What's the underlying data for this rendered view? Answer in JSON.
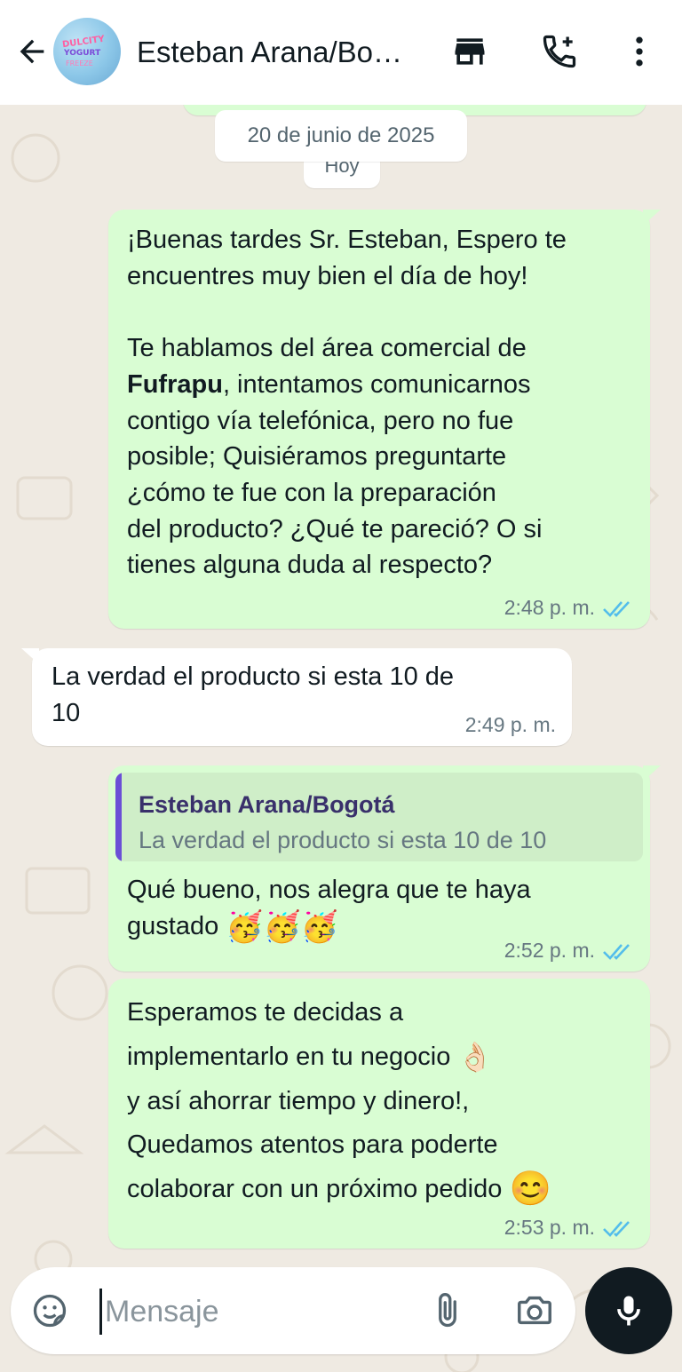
{
  "header": {
    "contact_name": "Esteban Arana/Bo…",
    "icons": {
      "back": "arrow-left-icon",
      "store": "storefront-icon",
      "call": "phone-add-icon",
      "menu": "more-vertical-icon"
    },
    "avatar_text": [
      "DULCITY",
      "YOGURT",
      "FREEZE"
    ]
  },
  "chat": {
    "date_chip": "20 de junio de 2025",
    "today_chip": "Hoy",
    "messages": [
      {
        "direction": "out",
        "line1": "¡Buenas tardes Sr. Esteban, Espero te",
        "line2": "encuentres muy bien el día de hoy!",
        "line3": "Te hablamos del área comercial de",
        "bold_word": "Fufrapu",
        "line4_rest": ", intentamos comunicarnos",
        "line5": "contigo vía telefónica, pero no fue",
        "line6": "posible; Quisiéramos preguntarte",
        "line7": "¿cómo te fue con la preparación",
        "line8": "del producto? ¿Qué te pareció? O si",
        "line9": "tienes alguna duda al respecto?",
        "time": "2:48 p. m.",
        "status": "read"
      },
      {
        "direction": "in",
        "line1": "La verdad el producto si esta 10 de",
        "line2": "10",
        "time": "2:49 p. m."
      },
      {
        "direction": "out",
        "quote_author": "Esteban Arana/Bogotá",
        "quote_text": "La verdad el producto si esta 10 de 10",
        "line1": "Qué bueno, nos alegra que te haya",
        "line2": "gustado",
        "emoji": "🥳🥳🥳",
        "time": "2:52 p. m.",
        "status": "read"
      },
      {
        "direction": "out",
        "line1": "Esperamos te decidas a",
        "line2": "implementarlo en tu negocio",
        "emoji_ok": "👌🏻",
        "line3": "y así ahorrar tiempo y dinero!,",
        "line4": "Quedamos atentos para poderte",
        "line5": "colaborar con un próximo pedido",
        "emoji_smile": "😊",
        "time": "2:53 p. m.",
        "status": "read"
      }
    ]
  },
  "composer": {
    "placeholder": "Mensaje",
    "value": "",
    "icons": {
      "sticker": "sticker-icon",
      "attach": "paperclip-icon",
      "camera": "camera-icon",
      "mic": "microphone-icon"
    }
  },
  "colors": {
    "outgoing_bubble": "#d9fdd3",
    "incoming_bubble": "#ffffff",
    "read_ticks": "#53bdeb",
    "chat_background": "#efeae2"
  }
}
